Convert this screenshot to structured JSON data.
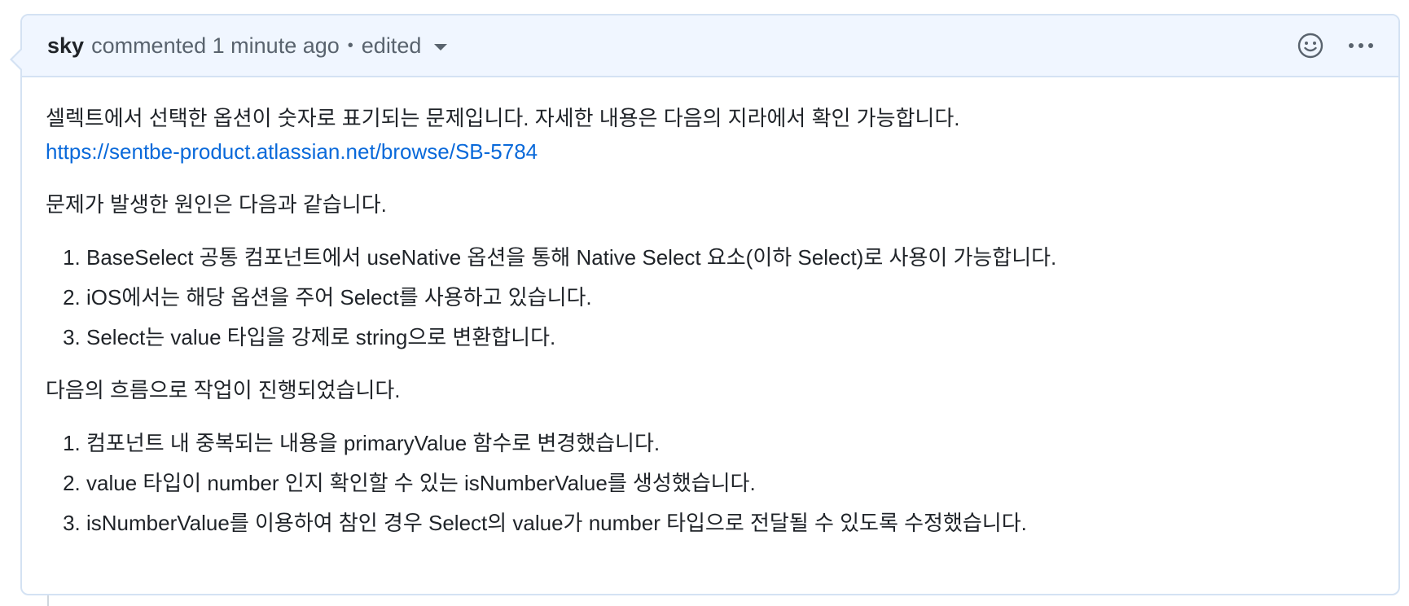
{
  "header": {
    "author": "sky",
    "action": "commented",
    "time": "1 minute ago",
    "separator": "•",
    "edited_label": "edited"
  },
  "icons": {
    "reaction": "smiley-icon",
    "more": "kebab-horizontal-icon",
    "edited_dropdown": "triangle-down-icon"
  },
  "colors": {
    "link": "#0969da",
    "header_bg": "#f0f6ff",
    "border": "#d4e2f3"
  },
  "body": {
    "intro": "셀렉트에서 선택한 옵션이 숫자로 표기되는 문제입니다. 자세한 내용은 다음의 지라에서 확인 가능합니다.",
    "link": "https://sentbe-product.atlassian.net/browse/SB-5784",
    "cause_heading": "문제가 발생한 원인은 다음과 같습니다.",
    "causes": [
      "BaseSelect 공통 컴포넌트에서 useNative 옵션을 통해 Native Select 요소(이하 Select)로 사용이 가능합니다.",
      "iOS에서는 해당 옵션을 주어 Select를 사용하고 있습니다.",
      "Select는 value 타입을 강제로 string으로 변환합니다."
    ],
    "flow_heading": "다음의 흐름으로 작업이 진행되었습니다.",
    "steps": [
      "컴포넌트 내 중복되는 내용을 primaryValue 함수로 변경했습니다.",
      "value 타입이 number 인지 확인할 수 있는 isNumberValue를 생성했습니다.",
      "isNumberValue를 이용하여 참인 경우 Select의 value가 number 타입으로 전달될 수 있도록 수정했습니다."
    ]
  }
}
